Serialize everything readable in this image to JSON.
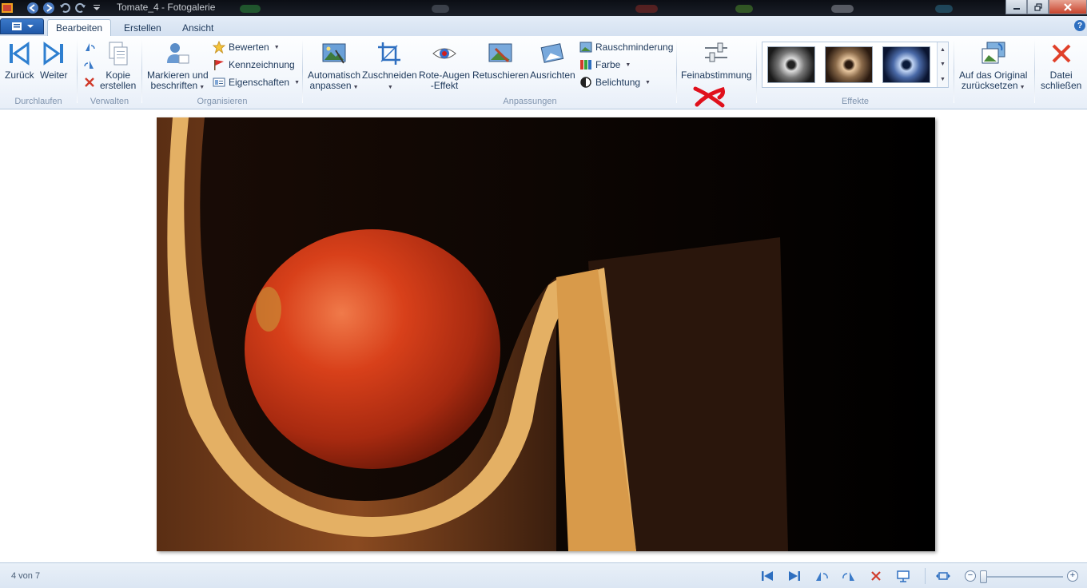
{
  "window": {
    "title": "Tomate_4 - Fotogalerie"
  },
  "tabs": [
    {
      "label": "Bearbeiten",
      "active": true
    },
    {
      "label": "Erstellen",
      "active": false
    },
    {
      "label": "Ansicht",
      "active": false
    }
  ],
  "help": "?",
  "ribbon": {
    "durchlaufen": {
      "label": "Durchlaufen",
      "back": "Zurück",
      "forward": "Weiter"
    },
    "verwalten": {
      "label": "Verwalten",
      "copy_line1": "Kopie",
      "copy_line2": "erstellen"
    },
    "organisieren": {
      "label": "Organisieren",
      "tag_line1": "Markieren und",
      "tag_line2": "beschriften",
      "rate": "Bewerten",
      "flag": "Kennzeichnung",
      "properties": "Eigenschaften"
    },
    "anpassungen": {
      "label": "Anpassungen",
      "auto_line1": "Automatisch",
      "auto_line2": "anpassen",
      "crop": "Zuschneiden",
      "redeye_line1": "Rote-Augen",
      "redeye_line2": "-Effekt",
      "retouch": "Retuschieren",
      "straighten": "Ausrichten",
      "noise": "Rauschminderung",
      "color": "Farbe",
      "exposure": "Belichtung",
      "finetune": "Feinabstimmung"
    },
    "effekte": {
      "label": "Effekte"
    },
    "revert": {
      "line1": "Auf das Original",
      "line2": "zurücksetzen"
    },
    "close": {
      "line1": "Datei",
      "line2": "schließen"
    }
  },
  "status": {
    "position": "4 von 7"
  },
  "colors": {
    "accent": "#2e6fc0",
    "annotation": "#e0101c"
  }
}
